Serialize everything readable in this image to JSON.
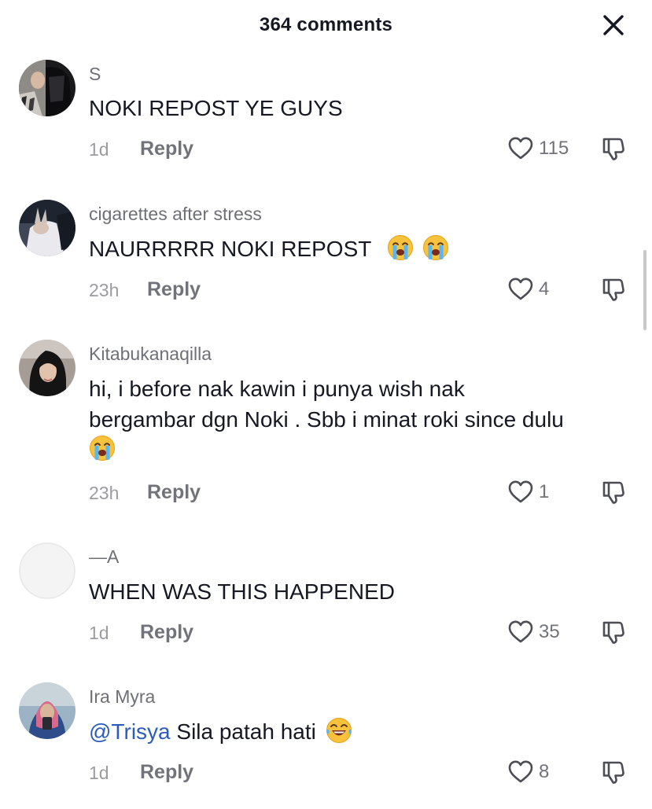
{
  "header": {
    "title": "364 comments",
    "close_icon": "close-icon"
  },
  "comments": [
    {
      "username": "S",
      "text": "NOKI REPOST YE GUYS",
      "time": "1d",
      "reply_label": "Reply",
      "likes": "115"
    },
    {
      "username": "cigarettes after stress",
      "text": "NAURRRRR NOKI REPOST",
      "emoji": "😭 😭",
      "time": "23h",
      "reply_label": "Reply",
      "likes": "4"
    },
    {
      "username": "Kitabukanaqilla",
      "text_line1": "hi, i before nak kawin i punya wish nak",
      "text_line2": "bergambar dgn Noki . Sbb i minat roki since dulu",
      "emoji": "😭",
      "time": "23h",
      "reply_label": "Reply",
      "likes": "1"
    },
    {
      "username": "—A",
      "text": "WHEN WAS THIS HAPPENED",
      "time": "1d",
      "reply_label": "Reply",
      "likes": "35"
    },
    {
      "username": "Ira Myra",
      "mention": "@Trisya",
      "text": "Sila patah hati",
      "emoji": "😂",
      "time": "1d",
      "reply_label": "Reply",
      "likes": "8"
    }
  ],
  "icons": {
    "like": "heart-outline-icon",
    "dislike": "thumbs-down-icon",
    "crying": "loudly-crying-face-emoji",
    "laughing": "face-with-tears-of-joy-emoji"
  },
  "colors": {
    "mention": "#2b5db9",
    "username": "#6f7077",
    "meta": "#9b9ba1",
    "text": "#161823"
  }
}
